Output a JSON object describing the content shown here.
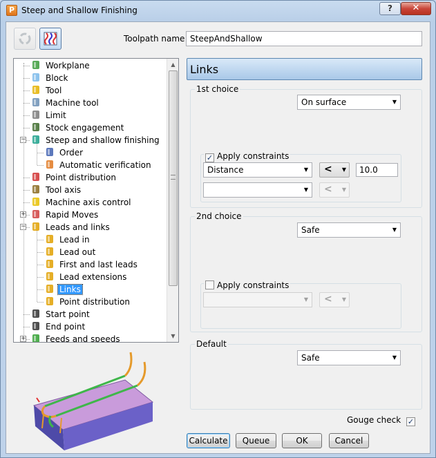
{
  "window": {
    "title": "Steep and Shallow Finishing",
    "app_icon_letter": "P",
    "help_glyph": "?",
    "close_glyph": "✕"
  },
  "toolpath": {
    "label": "Toolpath name",
    "value": "SteepAndShallow"
  },
  "tree": {
    "items": [
      {
        "label": "Workplane",
        "icon": "workplane-icon"
      },
      {
        "label": "Block",
        "icon": "block-icon"
      },
      {
        "label": "Tool",
        "icon": "tool-icon"
      },
      {
        "label": "Machine tool",
        "icon": "machine-tool-icon"
      },
      {
        "label": "Limit",
        "icon": "limit-icon"
      },
      {
        "label": "Stock engagement",
        "icon": "stock-engagement-icon"
      },
      {
        "label": "Steep and shallow finishing",
        "icon": "steep-shallow-icon",
        "expanded": true
      },
      {
        "label": "Order",
        "icon": "order-icon"
      },
      {
        "label": "Automatic verification",
        "icon": "verification-icon"
      },
      {
        "label": "Point distribution",
        "icon": "point-distribution-icon"
      },
      {
        "label": "Tool axis",
        "icon": "tool-axis-icon"
      },
      {
        "label": "Machine axis control",
        "icon": "axis-control-icon"
      },
      {
        "label": "Rapid Moves",
        "icon": "rapid-moves-icon",
        "expanded": false
      },
      {
        "label": "Leads and links",
        "icon": "leads-links-icon",
        "expanded": true
      },
      {
        "label": "Lead in",
        "icon": "lead-icon"
      },
      {
        "label": "Lead out",
        "icon": "lead-icon"
      },
      {
        "label": "First and last leads",
        "icon": "lead-icon"
      },
      {
        "label": "Lead extensions",
        "icon": "lead-icon"
      },
      {
        "label": "Links",
        "icon": "lead-icon",
        "selected": true
      },
      {
        "label": "Point distribution",
        "icon": "lead-icon"
      },
      {
        "label": "Start point",
        "icon": "start-point-icon"
      },
      {
        "label": "End point",
        "icon": "end-point-icon"
      },
      {
        "label": "Feeds and speeds",
        "icon": "feeds-speeds-icon",
        "expanded": false
      }
    ]
  },
  "panel": {
    "title": "Links",
    "first_choice": {
      "label": "1st choice",
      "value": "On surface",
      "apply_constraints_label": "Apply constraints",
      "apply_constraints_checked": true,
      "constraint1_type": "Distance",
      "constraint1_operator": "<",
      "constraint1_value": "10.0",
      "constraint2_type": "",
      "constraint2_operator": "<"
    },
    "second_choice": {
      "label": "2nd choice",
      "value": "Safe",
      "apply_constraints_label": "Apply constraints",
      "apply_constraints_checked": false,
      "constraint_type": "",
      "constraint_operator": "<"
    },
    "default": {
      "label": "Default",
      "value": "Safe"
    },
    "gouge_check_label": "Gouge check",
    "gouge_check_checked": true
  },
  "buttons": {
    "calculate": "Calculate",
    "queue": "Queue",
    "ok": "OK",
    "cancel": "Cancel"
  },
  "colors": {
    "header_gradient_top": "#d9e9f8",
    "header_gradient_bottom": "#a9c8e8",
    "selection": "#3399ff",
    "block_top": "#c99bdb",
    "block_front": "#6b61c8",
    "toolpath_green": "#3fb64a",
    "toolpath_orange": "#e59a2b"
  }
}
